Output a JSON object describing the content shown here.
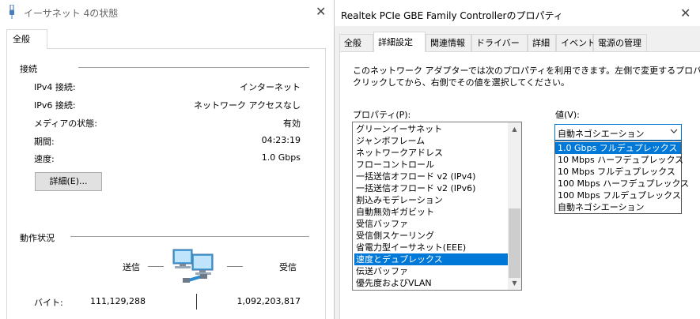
{
  "left_window": {
    "title": "イーサネット 4の状態",
    "close_glyph": "✕",
    "tab": "全般",
    "connection": {
      "heading": "接続",
      "rows": [
        {
          "label": "IPv4 接続:",
          "value": "インターネット"
        },
        {
          "label": "IPv6 接続:",
          "value": "ネットワーク アクセスなし"
        },
        {
          "label": "メディアの状態:",
          "value": "有効"
        },
        {
          "label": "期間:",
          "value": "04:23:19"
        },
        {
          "label": "速度:",
          "value": "1.0 Gbps"
        }
      ],
      "details_button": "詳細(E)..."
    },
    "activity": {
      "heading": "動作状況",
      "sent_label": "送信",
      "received_label": "受信",
      "bytes_label": "バイト:",
      "bytes_sent": "111,129,288",
      "bytes_received": "1,092,203,817"
    }
  },
  "right_window": {
    "title": "Realtek PCIe GBE Family Controllerのプロパティ",
    "close_glyph": "✕",
    "tabs": [
      "全般",
      "詳細設定",
      "関連情報",
      "ドライバー",
      "詳細",
      "イベント",
      "電源の管理"
    ],
    "active_tab": "詳細設定",
    "description_line1": "このネットワーク アダプターでは次のプロパティを利用できます。左側で変更するプロパティを",
    "description_line2": "クリックしてから、右側でその値を選択してください。",
    "property_label": "プロパティ(P):",
    "value_label": "値(V):",
    "properties": [
      "グリーンイーサネット",
      "ジャンボフレーム",
      "ネットワークアドレス",
      "フローコントロール",
      "一括送信オフロード v2 (IPv4)",
      "一括送信オフロード v2 (IPv6)",
      "割込みモデレーション",
      "自動無効ギガビット",
      "受信バッファ",
      "受信側スケーリング",
      "省電力型イーサネット(EEE)",
      "速度とデュプレックス",
      "伝送バッファ",
      "優先度およびVLAN"
    ],
    "selected_property": "速度とデュプレックス",
    "selected_value": "自動ネゴシエーション",
    "value_options": [
      "1.0 Gbps フルデュプレックス",
      "10 Mbps ハーフデュプレックス",
      "10 Mbps フルデュプレックス",
      "100 Mbps ハーフデュプレックス",
      "100 Mbps フルデュプレックス",
      "自動ネゴシエーション"
    ],
    "highlighted_option": "1.0 Gbps フルデュプレックス"
  },
  "icons": {
    "network": "network-computers-icon",
    "window": "network-adapter-icon",
    "scroll_up": "scroll-up-icon",
    "scroll_down": "scroll-down-icon",
    "dropdown": "chevron-down-icon"
  },
  "colors": {
    "selection": "#0078d7",
    "panel": "#f0f0f0",
    "button": "#e1e1e1"
  }
}
